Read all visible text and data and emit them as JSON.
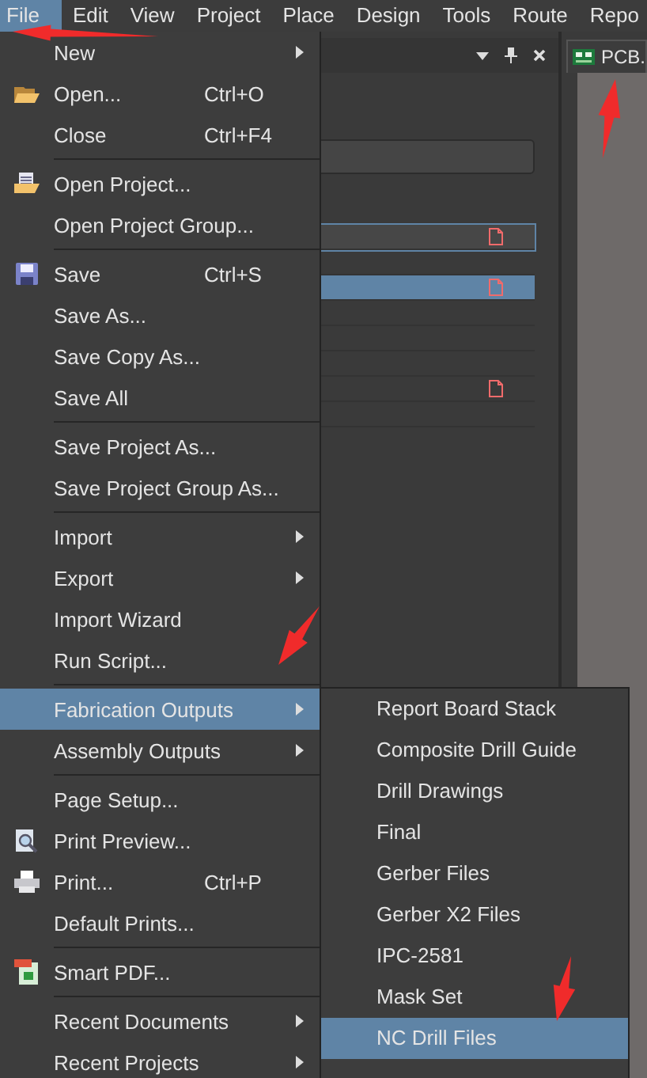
{
  "menubar": [
    {
      "label": "File",
      "selected": true
    },
    {
      "label": "Edit",
      "selected": false
    },
    {
      "label": "View",
      "selected": false
    },
    {
      "label": "Project",
      "selected": false
    },
    {
      "label": "Place",
      "selected": false
    },
    {
      "label": "Design",
      "selected": false
    },
    {
      "label": "Tools",
      "selected": false
    },
    {
      "label": "Route",
      "selected": false
    },
    {
      "label": "Repo",
      "selected": false
    }
  ],
  "panel": {
    "rows": [
      {
        "selected": false,
        "focused": true,
        "file_icon": true
      },
      {
        "selected": false,
        "focused": false,
        "file_icon": false
      },
      {
        "selected": true,
        "focused": false,
        "file_icon": true
      },
      {
        "selected": false,
        "focused": false,
        "file_icon": false
      },
      {
        "selected": false,
        "focused": false,
        "file_icon": false
      },
      {
        "selected": false,
        "focused": false,
        "file_icon": false
      },
      {
        "selected": false,
        "focused": false,
        "file_icon": true
      },
      {
        "selected": false,
        "focused": false,
        "file_icon": false
      }
    ]
  },
  "document_tab": {
    "label": "PCB."
  },
  "file_menu": [
    {
      "kind": "item",
      "label": "New",
      "submenu": true,
      "selected": false
    },
    {
      "kind": "item",
      "label": "Open...",
      "shortcut": "Ctrl+O",
      "submenu": false,
      "selected": false
    },
    {
      "kind": "item",
      "label": "Close",
      "shortcut": "Ctrl+F4",
      "submenu": false,
      "selected": false
    },
    {
      "kind": "separator"
    },
    {
      "kind": "item",
      "label": "Open Project...",
      "submenu": false,
      "selected": false
    },
    {
      "kind": "item",
      "label": "Open Project Group...",
      "submenu": false,
      "selected": false
    },
    {
      "kind": "separator"
    },
    {
      "kind": "item",
      "label": "Save",
      "shortcut": "Ctrl+S",
      "submenu": false,
      "selected": false
    },
    {
      "kind": "item",
      "label": "Save As...",
      "submenu": false,
      "selected": false
    },
    {
      "kind": "item",
      "label": "Save Copy As...",
      "submenu": false,
      "selected": false
    },
    {
      "kind": "item",
      "label": "Save All",
      "submenu": false,
      "selected": false
    },
    {
      "kind": "separator"
    },
    {
      "kind": "item",
      "label": "Save Project As...",
      "submenu": false,
      "selected": false
    },
    {
      "kind": "item",
      "label": "Save Project Group As...",
      "submenu": false,
      "selected": false
    },
    {
      "kind": "separator"
    },
    {
      "kind": "item",
      "label": "Import",
      "submenu": true,
      "selected": false
    },
    {
      "kind": "item",
      "label": "Export",
      "submenu": true,
      "selected": false
    },
    {
      "kind": "item",
      "label": "Import Wizard",
      "submenu": false,
      "selected": false
    },
    {
      "kind": "item",
      "label": "Run Script...",
      "submenu": false,
      "selected": false
    },
    {
      "kind": "separator"
    },
    {
      "kind": "item",
      "label": "Fabrication Outputs",
      "submenu": true,
      "selected": true
    },
    {
      "kind": "item",
      "label": "Assembly Outputs",
      "submenu": true,
      "selected": false
    },
    {
      "kind": "separator"
    },
    {
      "kind": "item",
      "label": "Page Setup...",
      "submenu": false,
      "selected": false
    },
    {
      "kind": "item",
      "label": "Print Preview...",
      "submenu": false,
      "selected": false
    },
    {
      "kind": "item",
      "label": "Print...",
      "shortcut": "Ctrl+P",
      "submenu": false,
      "selected": false
    },
    {
      "kind": "item",
      "label": "Default Prints...",
      "submenu": false,
      "selected": false
    },
    {
      "kind": "separator"
    },
    {
      "kind": "item",
      "label": "Smart PDF...",
      "submenu": false,
      "selected": false
    },
    {
      "kind": "separator"
    },
    {
      "kind": "item",
      "label": "Recent Documents",
      "submenu": true,
      "selected": false
    },
    {
      "kind": "item",
      "label": "Recent Projects",
      "submenu": true,
      "selected": false
    }
  ],
  "fabrication_submenu": [
    {
      "label": "Report Board Stack",
      "selected": false
    },
    {
      "label": "Composite Drill Guide",
      "selected": false
    },
    {
      "label": "Drill Drawings",
      "selected": false
    },
    {
      "label": "Final",
      "selected": false
    },
    {
      "label": "Gerber Files",
      "selected": false
    },
    {
      "label": "Gerber X2 Files",
      "selected": false
    },
    {
      "label": "IPC-2581",
      "selected": false
    },
    {
      "label": "Mask Set",
      "selected": false
    },
    {
      "label": "NC Drill Files",
      "selected": true
    }
  ]
}
